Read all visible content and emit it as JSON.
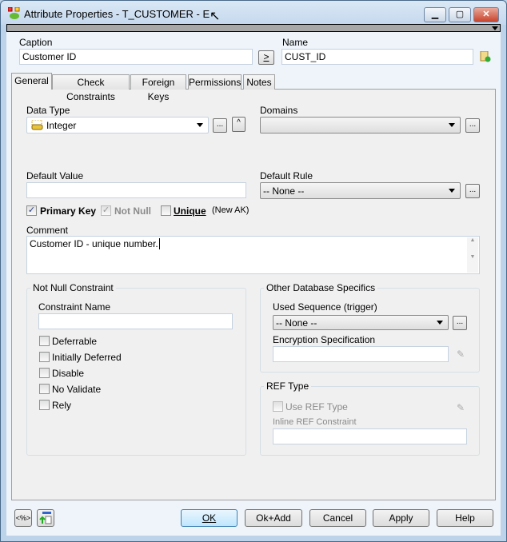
{
  "window": {
    "title": "Attribute Properties - T_CUSTOMER - E",
    "minimize": "▁",
    "maximize": "▢",
    "close": "✕"
  },
  "header": {
    "caption_label": "Caption",
    "caption_value": "Customer ID",
    "copy_button": ">",
    "name_label": "Name",
    "name_value": "CUST_ID"
  },
  "tabs": [
    {
      "label": "General"
    },
    {
      "label": "Check Constraints"
    },
    {
      "label": "Foreign Keys"
    },
    {
      "label": "Permissions"
    },
    {
      "label": "Notes"
    }
  ],
  "general": {
    "data_type_label": "Data Type",
    "data_type_value": "Integer",
    "ellipsis": "...",
    "up": "^",
    "domains_label": "Domains",
    "domains_value": "",
    "default_value_label": "Default Value",
    "default_value": "",
    "default_rule_label": "Default Rule",
    "default_rule_value": "-- None --",
    "primary_key_label": "Primary Key",
    "primary_key_checked": true,
    "not_null_label": "Not Null",
    "not_null_checked": true,
    "unique_label": "Unique",
    "unique_checked": false,
    "new_ak": "(New AK)",
    "comment_label": "Comment",
    "comment_value": "Customer ID - unique number.",
    "not_null_group": {
      "title": "Not Null Constraint",
      "constraint_name_label": "Constraint Name",
      "constraint_name_value": "",
      "options": [
        {
          "label": "Deferrable",
          "checked": false
        },
        {
          "label": "Initially Deferred",
          "checked": false
        },
        {
          "label": "Disable",
          "checked": false
        },
        {
          "label": "No Validate",
          "checked": false
        },
        {
          "label": "Rely",
          "checked": false
        }
      ]
    },
    "other_db_group": {
      "title": "Other Database Specifics",
      "used_sequence_label": "Used Sequence (trigger)",
      "used_sequence_value": "-- None --",
      "encryption_label": "Encryption Specification",
      "encryption_value": ""
    },
    "ref_group": {
      "title": "REF Type",
      "use_ref_label": "Use REF Type",
      "use_ref_checked": false,
      "inline_ref_label": "Inline REF Constraint",
      "inline_ref_value": ""
    }
  },
  "footer": {
    "macro_button": "<%>",
    "ok": "OK",
    "ok_add": "Ok+Add",
    "cancel": "Cancel",
    "apply": "Apply",
    "help": "Help"
  }
}
